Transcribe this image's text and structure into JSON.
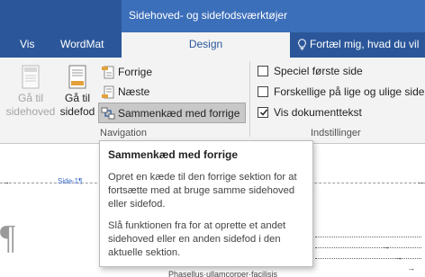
{
  "context_header": "Sidehoved- og sidefodsværktøjer",
  "tabs": {
    "vis": "Vis",
    "wordmat": "WordMat",
    "design": "Design",
    "tellme": "Fortæl mig, hvad du vil"
  },
  "ribbon": {
    "prev_header_line1": "Gå til",
    "prev_header_line2": "sidehoved",
    "goto_footer_line1": "Gå til",
    "goto_footer_line2": "sidefod",
    "forrige": "Forrige",
    "naeste": "Næste",
    "link_previous": "Sammenkæd med forrige",
    "group_navigation": "Navigation",
    "group_settings": "Indstillinger",
    "checkboxes": [
      {
        "label": "Speciel første side",
        "checked": false
      },
      {
        "label": "Forskellige på lige og ulige sider",
        "checked": false
      },
      {
        "label": "Vis dokumenttekst",
        "checked": true
      }
    ]
  },
  "document": {
    "header_label": "Side-1¶",
    "bottom_text": "Phasellus·ullamcorper·facilisis"
  },
  "tooltip": {
    "title": "Sammenkæd med forrige",
    "para1": "Opret en kæde til den forrige sektion for at fortsætte med at bruge samme sidehoved eller sidefod.",
    "para2": "Slå funktionen fra for at oprette et andet sidehoved eller en anden sidefod i den aktuelle sektion."
  },
  "colors": {
    "accent": "#2b579a",
    "context_tab": "#3c6fba",
    "link_blue": "#3366cc"
  },
  "icons": [
    "lightbulb-icon",
    "page-header-icon",
    "page-footer-icon",
    "previous-icon",
    "next-icon",
    "link-icon",
    "checkmark-icon"
  ]
}
